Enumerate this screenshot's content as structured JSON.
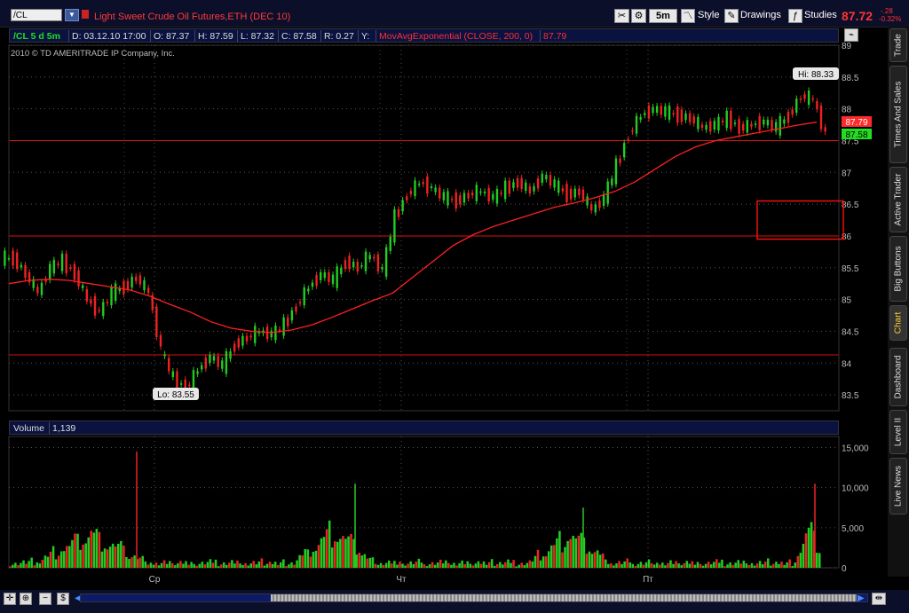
{
  "header": {
    "symbol": "/CL",
    "title": "Light Sweet Crude Oil Futures,ETH (DEC 10)",
    "timeframe": "5m",
    "style_label": "Style",
    "drawings_label": "Drawings",
    "studies_label": "Studies",
    "last_price": "87.72",
    "change_1": "-.28",
    "change_2": "-0.32%"
  },
  "info_bar": {
    "symbol_period": "/CL 5 d 5m",
    "date": "D: 03.12.10 17:00",
    "open": "O: 87.37",
    "high": "H: 87.59",
    "low": "L: 87.32",
    "close": "C: 87.58",
    "range": "R: 0.27",
    "y": "Y:",
    "study": "MovAvgExponential (CLOSE, 200, 0)",
    "study_value": "87.79"
  },
  "copyright": "2010 © TD AMERITRADE IP Company, Inc.",
  "volume_bar": {
    "label": "Volume",
    "value": "1,139"
  },
  "side_tabs": [
    "Trade",
    "Times And Sales",
    "Active Trader",
    "Big Buttons",
    "Chart",
    "Dashboard",
    "Level II",
    "Live News"
  ],
  "colors": {
    "up": "#22cc22",
    "down": "#ee2222",
    "ema": "#ff2020",
    "price_tag_red": "#ff2a2a",
    "price_tag_green": "#22dd22"
  },
  "chart_data": [
    {
      "type": "candlestick",
      "y_ticks": [
        "83.5",
        "84",
        "84.5",
        "85",
        "85.5",
        "86",
        "86.5",
        "87",
        "87.5",
        "88",
        "88.5",
        "89"
      ],
      "ylim": [
        83.25,
        89
      ],
      "x_ticks": [
        "Ср",
        "Чт",
        "Пт"
      ],
      "hi_label": "Hi: 88.33",
      "lo_label": "Lo: 83.55",
      "price_tags": [
        "87.79",
        "87.58"
      ],
      "horizontal_lines": [
        87.5,
        86.0,
        84.13
      ],
      "rectangle": {
        "price_top": 86.55,
        "price_bottom": 85.95
      },
      "series": [
        {
          "name": "Close",
          "values": [
            85.65,
            85.4,
            85.1,
            85.5,
            85.6,
            85.4,
            85.0,
            84.8,
            85.1,
            85.2,
            85.35,
            85.1,
            84.2,
            83.75,
            83.6,
            83.9,
            84.1,
            83.95,
            84.3,
            84.4,
            84.5,
            84.45,
            84.6,
            84.9,
            85.2,
            85.4,
            85.3,
            85.6,
            85.5,
            85.7,
            85.45,
            86.3,
            86.65,
            86.85,
            86.75,
            86.6,
            86.55,
            86.65,
            86.7,
            86.6,
            86.75,
            86.85,
            86.7,
            86.95,
            86.8,
            86.65,
            86.7,
            86.4,
            86.6,
            87.1,
            87.6,
            87.9,
            88.0,
            87.95,
            87.9,
            87.85,
            87.7,
            87.75,
            87.85,
            87.7,
            87.75,
            87.8,
            87.7,
            87.9,
            88.2,
            88.15,
            87.58
          ]
        },
        {
          "name": "MovAvgExponential (CLOSE, 200, 0)",
          "values": [
            85.25,
            85.3,
            85.32,
            85.3,
            85.25,
            85.2,
            85.15,
            85.05,
            84.92,
            84.8,
            84.65,
            84.55,
            84.5,
            84.48,
            84.52,
            84.6,
            84.72,
            84.85,
            84.98,
            85.1,
            85.35,
            85.6,
            85.85,
            86.02,
            86.15,
            86.25,
            86.35,
            86.45,
            86.52,
            86.6,
            86.7,
            86.85,
            87.05,
            87.25,
            87.4,
            87.5,
            87.56,
            87.62,
            87.68,
            87.74,
            87.79
          ]
        }
      ]
    },
    {
      "type": "bar",
      "name": "Volume",
      "y_ticks": [
        "0",
        "5,000",
        "10,000",
        "15,000"
      ],
      "ylim": [
        0,
        15500
      ],
      "spikes": [
        {
          "day_position": "Ср",
          "value": 14500
        },
        {
          "day_position": "Чт",
          "value": 10500
        },
        {
          "day_position": "Пт",
          "value": 7500
        }
      ]
    }
  ]
}
